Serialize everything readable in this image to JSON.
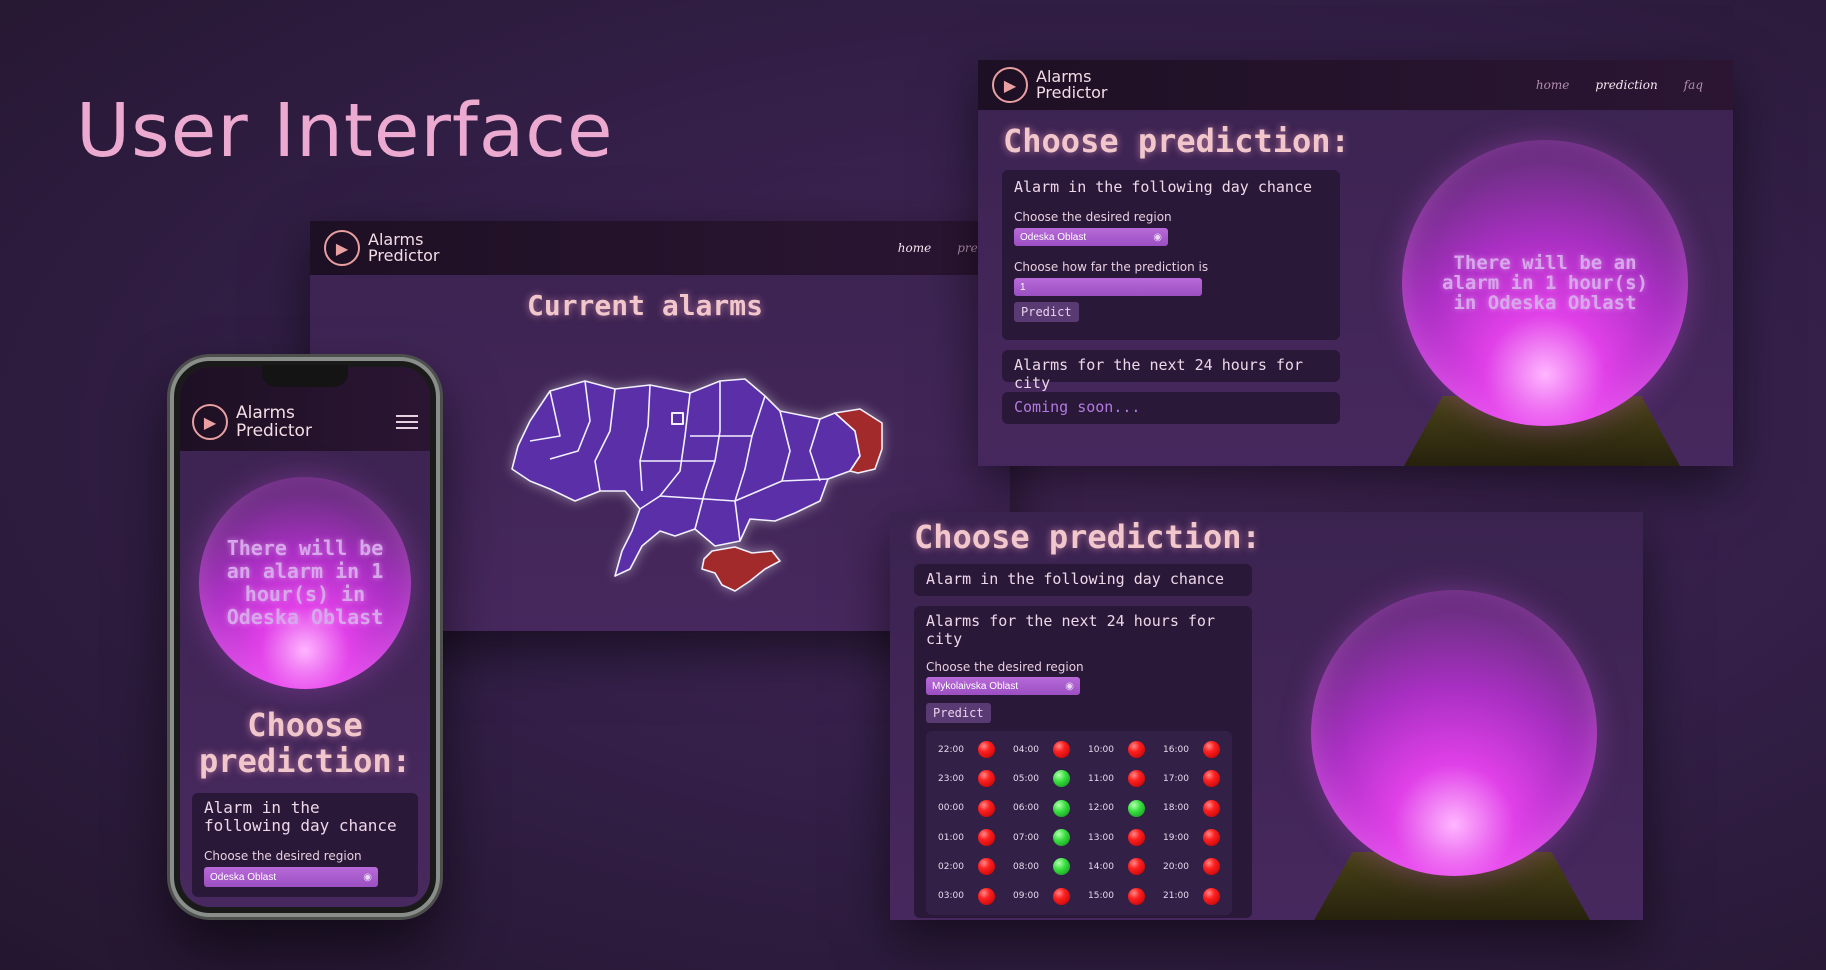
{
  "slide": {
    "title": "User Interface"
  },
  "brand": {
    "line1": "Alarms",
    "line2": "Predictor"
  },
  "nav": {
    "home": "home",
    "prediction": "prediction",
    "faq": "faq",
    "prediction_truncated": "predic"
  },
  "map_page": {
    "title": "Current alarms",
    "alarm_color": "#a32a2a",
    "region_color": "#5a2fa8"
  },
  "prediction_top": {
    "title": "Choose prediction:",
    "card1_title": "Alarm in the following day chance",
    "region_label": "Choose the desired region",
    "region_value": "Odeska Oblast",
    "horizon_label": "Choose how far the prediction is",
    "horizon_value": "1",
    "predict_label": "Predict",
    "card2_title": "Alarms for the next 24 hours for city",
    "coming_soon": "Coming soon...",
    "ball_text": "There will be an alarm in 1 hour(s) in Odeska Oblast"
  },
  "prediction_bottom": {
    "title": "Choose prediction:",
    "card1_title": "Alarm in the following day chance",
    "card2_title": "Alarms for the next 24 hours for city",
    "region_label": "Choose the desired region",
    "region_value": "Mykolaivska Oblast",
    "predict_label": "Predict",
    "hours": [
      {
        "time": "22:00",
        "status": "red"
      },
      {
        "time": "04:00",
        "status": "red"
      },
      {
        "time": "10:00",
        "status": "red"
      },
      {
        "time": "16:00",
        "status": "red"
      },
      {
        "time": "23:00",
        "status": "red"
      },
      {
        "time": "05:00",
        "status": "green"
      },
      {
        "time": "11:00",
        "status": "red"
      },
      {
        "time": "17:00",
        "status": "red"
      },
      {
        "time": "00:00",
        "status": "red"
      },
      {
        "time": "06:00",
        "status": "green"
      },
      {
        "time": "12:00",
        "status": "green"
      },
      {
        "time": "18:00",
        "status": "red"
      },
      {
        "time": "01:00",
        "status": "red"
      },
      {
        "time": "07:00",
        "status": "green"
      },
      {
        "time": "13:00",
        "status": "red"
      },
      {
        "time": "19:00",
        "status": "red"
      },
      {
        "time": "02:00",
        "status": "red"
      },
      {
        "time": "08:00",
        "status": "green"
      },
      {
        "time": "14:00",
        "status": "red"
      },
      {
        "time": "20:00",
        "status": "red"
      },
      {
        "time": "03:00",
        "status": "red"
      },
      {
        "time": "09:00",
        "status": "red"
      },
      {
        "time": "15:00",
        "status": "red"
      },
      {
        "time": "21:00",
        "status": "red"
      }
    ]
  },
  "phone": {
    "ball_text": "There will be an alarm in 1 hour(s) in Odeska Oblast",
    "title": "Choose prediction:",
    "card_title": "Alarm in the following day chance",
    "region_label": "Choose the desired region",
    "region_value": "Odeska Oblast"
  },
  "icons": {
    "logo": "megaphone-icon",
    "eye": "eye-icon",
    "menu": "hamburger-icon"
  }
}
